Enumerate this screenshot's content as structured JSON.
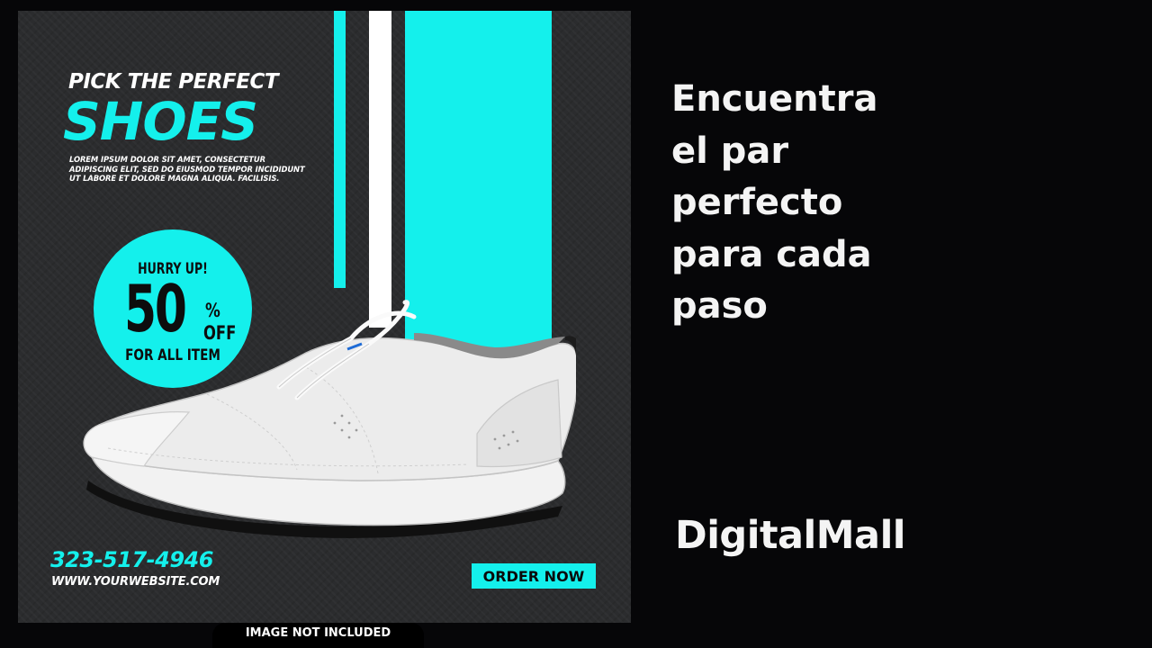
{
  "colors": {
    "accent": "#14f0ec",
    "poster_bg": "#2b2c2e",
    "page_bg": "#060608",
    "stripe_white": "#ffffff"
  },
  "poster": {
    "headline_top": "PICK THE PERFECT",
    "headline_main": "SHOES",
    "body_text": "LOREM IPSUM DOLOR SIT AMET, CONSECTETUR ADIPISCING ELIT, SED DO EIUSMOD TEMPOR INCIDIDUNT UT LABORE ET DOLORE MAGNA ALIQUA. FACILISIS.",
    "badge": {
      "hurry": "HURRY UP!",
      "number": "50",
      "percent": "%",
      "off": "OFF",
      "subtitle": "FOR ALL ITEM"
    },
    "phone": "323-517-4946",
    "website": "WWW.YOURWEBSITE.COM",
    "order_button": "ORDER NOW",
    "disclaimer": "IMAGE NOT INCLUDED",
    "shoe_image": "white-sneaker"
  },
  "tagline": {
    "lines": [
      "Encuentra",
      "el par",
      "perfecto",
      "para cada",
      "paso"
    ]
  },
  "brand": "DigitalMall"
}
